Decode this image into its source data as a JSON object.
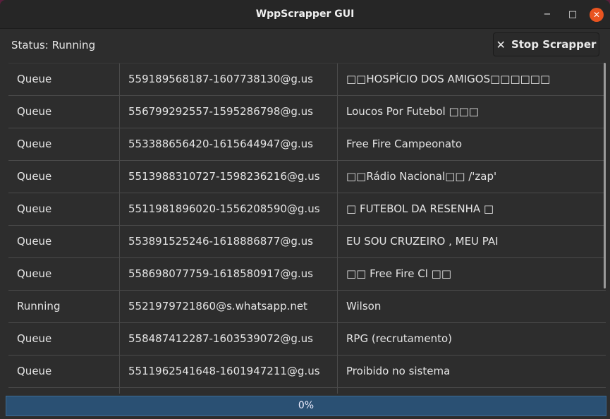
{
  "window": {
    "title": "WppScrapper GUI"
  },
  "controls": {
    "minimize": "−",
    "maximize": "□",
    "close": "✕"
  },
  "status_text": "Status: Running",
  "stop_button": {
    "icon": "✕",
    "label": "Stop Scrapper"
  },
  "rows": [
    {
      "status": "Queue",
      "id": "559189568187-1607738130@g.us",
      "name": "□□HOSPÍCIO DOS AMIGOS□□□□□□"
    },
    {
      "status": "Queue",
      "id": "556799292557-1595286798@g.us",
      "name": "Loucos Por Futebol □□□"
    },
    {
      "status": "Queue",
      "id": "553388656420-1615644947@g.us",
      "name": "Free Fire Campeonato"
    },
    {
      "status": "Queue",
      "id": "5513988310727-1598236216@g.us",
      "name": "□□Rádio Nacional□□ /'zap'"
    },
    {
      "status": "Queue",
      "id": "5511981896020-1556208590@g.us",
      "name": "□ FUTEBOL DA RESENHA □"
    },
    {
      "status": "Queue",
      "id": "553891525246-1618886877@g.us",
      "name": "EU SOU CRUZEIRO , MEU PAI"
    },
    {
      "status": "Queue",
      "id": "558698077759-1618580917@g.us",
      "name": "□□ Free Fire Cl □□"
    },
    {
      "status": "Running",
      "id": "5521979721860@s.whatsapp.net",
      "name": "Wilson"
    },
    {
      "status": "Queue",
      "id": "558487412287-1603539072@g.us",
      "name": "RPG (recrutamento)"
    },
    {
      "status": "Queue",
      "id": "5511962541648-1601947211@g.us",
      "name": "Proibido no sistema"
    },
    {
      "status": "",
      "id": "",
      "name": ""
    }
  ],
  "progress": {
    "value": 0,
    "label": "0%"
  },
  "colors": {
    "accent_close": "#e95420",
    "progress_fill": "#2a5073",
    "window_bg": "#2d2d2d"
  }
}
